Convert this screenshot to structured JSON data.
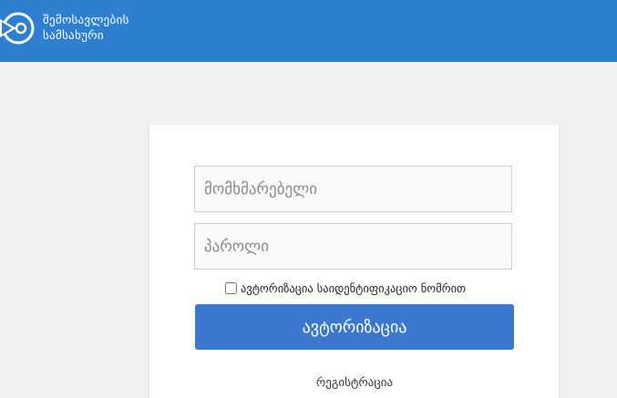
{
  "header": {
    "logo_line1": "შემოსავლების",
    "logo_line2": "სამსახური"
  },
  "login_form": {
    "username_placeholder": "მომხმარებელი",
    "password_placeholder": "პაროლი",
    "id_checkbox_label": "ავტორიზაცია საიდენტიფიკაციო ნომრით",
    "id_checkbox_checked": false,
    "login_button_label": "ავტორიზაცია",
    "register_link_label": "რეგისტრაცია"
  },
  "colors": {
    "header_bg": "#2f7fd1",
    "button_bg": "#3c78cf",
    "page_bg": "#f1f1f1"
  }
}
